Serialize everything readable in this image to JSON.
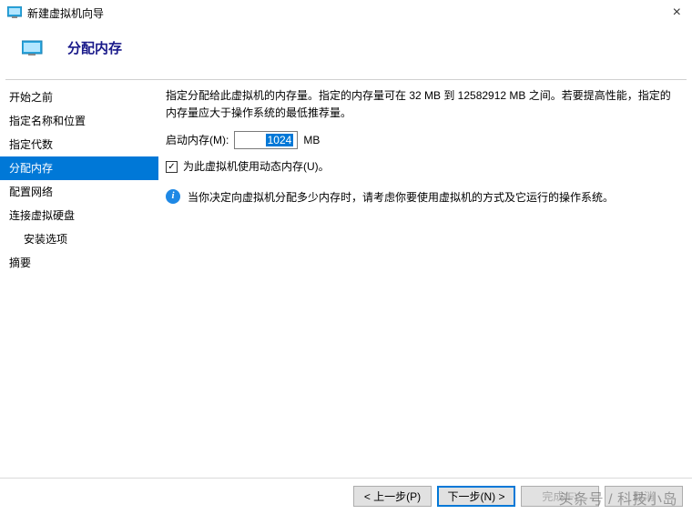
{
  "window": {
    "title": "新建虚拟机向导"
  },
  "header": {
    "title": "分配内存"
  },
  "sidebar": {
    "items": [
      {
        "label": "开始之前"
      },
      {
        "label": "指定名称和位置"
      },
      {
        "label": "指定代数"
      },
      {
        "label": "分配内存",
        "active": true
      },
      {
        "label": "配置网络"
      },
      {
        "label": "连接虚拟硬盘"
      },
      {
        "label": "安装选项",
        "indent": true
      },
      {
        "label": "摘要"
      }
    ]
  },
  "main": {
    "description": "指定分配给此虚拟机的内存量。指定的内存量可在 32 MB 到 12582912 MB 之间。若要提高性能，指定的内存量应大于操作系统的最低推荐量。",
    "mem_label": "启动内存(M):",
    "mem_value": "1024",
    "mem_unit": "MB",
    "dyn_checked": true,
    "dyn_label": "为此虚拟机使用动态内存(U)。",
    "info_text": "当你决定向虚拟机分配多少内存时，请考虑你要使用虚拟机的方式及它运行的操作系统。"
  },
  "footer": {
    "prev": "< 上一步(P)",
    "next": "下一步(N) >",
    "finish": "完成(F)",
    "cancel": "取消"
  },
  "watermark": "头条号 / 科技小岛"
}
